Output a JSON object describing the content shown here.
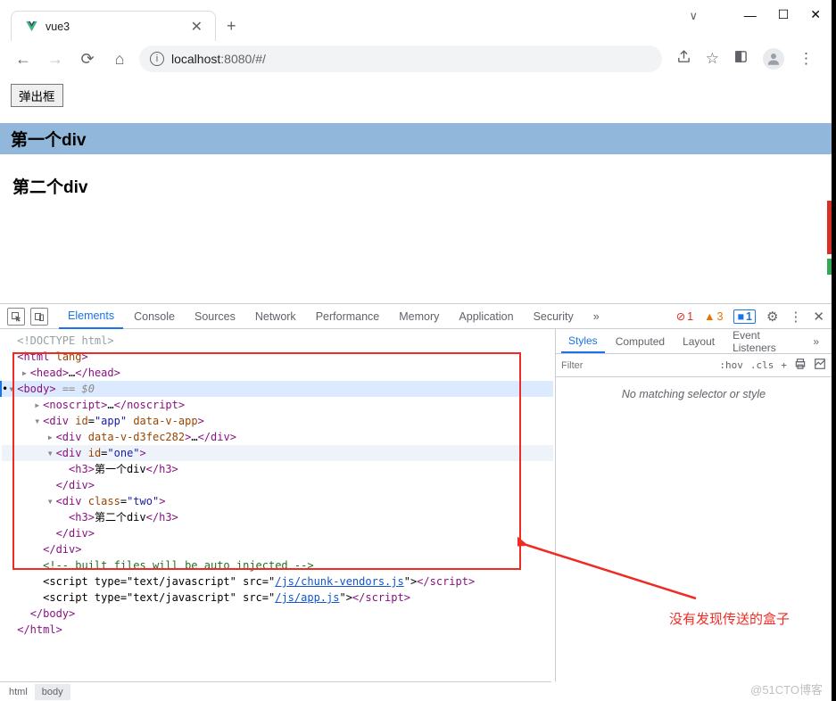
{
  "window": {
    "minimize": "—",
    "maximize": "☐",
    "close": "✕",
    "chevron": "∨"
  },
  "tab": {
    "title": "vue3",
    "close": "✕",
    "new_tab": "+"
  },
  "nav": {
    "back": "←",
    "forward": "→",
    "reload": "⟳",
    "home": "⌂",
    "info": "i"
  },
  "url": {
    "host": "localhost",
    "rest": ":8080/#/"
  },
  "toolbar": {
    "share": "⇧",
    "star": "☆",
    "ext": "◧",
    "menu": "⋮"
  },
  "page": {
    "popup_btn": "弹出框",
    "first_div": "第一个div",
    "second_div": "第二个div"
  },
  "devtools": {
    "tabs": [
      "Elements",
      "Console",
      "Sources",
      "Network",
      "Performance",
      "Memory",
      "Application",
      "Security"
    ],
    "active_tab": "Elements",
    "more": "»",
    "err_count": "1",
    "warn_count": "3",
    "info_count": "1",
    "gear": "⚙",
    "menu": "⋮",
    "close": "✕"
  },
  "elements": {
    "doctype": "<!DOCTYPE html>",
    "html_open": "<html lang>",
    "head": "<head>…</head>",
    "body_open": "<body>",
    "eq0": " == $0",
    "noscript": "<noscript>…</noscript>",
    "app_open": "<div id=\"app\" data-v-app>",
    "child_a": "<div data-v-d3fec282>…</div>",
    "one_open": "<div id=\"one\">",
    "h3_one": "<h3>第一个div</h3>",
    "div_close": "</div>",
    "two_open": "<div class=\"two\">",
    "h3_two": "<h3>第二个div</h3>",
    "comment": "<!-- built files will be auto injected -->",
    "script1_a": "<script type=\"text/javascript\" src=\"",
    "script1_src": "/js/chunk-vendors.js",
    "script2_src": "/js/app.js",
    "script_b": "\"></",
    "script_tag": "script",
    "script_close": ">",
    "body_close": "</body>",
    "html_close": "</html>"
  },
  "styles": {
    "tabs": [
      "Styles",
      "Computed",
      "Layout",
      "Event Listeners"
    ],
    "active": "Styles",
    "filter_placeholder": "Filter",
    "hov": ":hov",
    "cls": ".cls",
    "plus": "+",
    "no_match": "No matching selector or style"
  },
  "crumbs": {
    "html": "html",
    "body": "body"
  },
  "annotation": {
    "text": "没有发现传送的盒子"
  },
  "watermark": "@51CTO博客"
}
